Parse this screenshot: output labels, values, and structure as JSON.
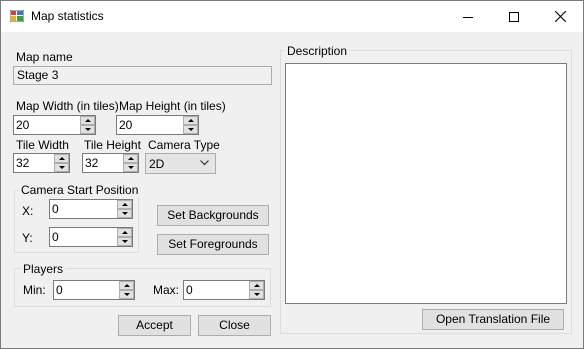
{
  "window": {
    "title": "Map statistics"
  },
  "map_name": {
    "label": "Map name",
    "value": "Stage 3"
  },
  "map_width": {
    "label": "Map Width (in tiles)",
    "value": "20"
  },
  "map_height": {
    "label": "Map Height (in tiles)",
    "value": "20"
  },
  "tile_width": {
    "label": "Tile Width",
    "value": "32"
  },
  "tile_height": {
    "label": "Tile Height",
    "value": "32"
  },
  "camera_type": {
    "label": "Camera Type",
    "value": "2D"
  },
  "camera_start": {
    "title": "Camera Start Position",
    "x_label": "X:",
    "x_value": "0",
    "y_label": "Y:",
    "y_value": "0"
  },
  "buttons": {
    "set_backgrounds": "Set Backgrounds",
    "set_foregrounds": "Set Foregrounds",
    "accept": "Accept",
    "close": "Close",
    "open_translation": "Open Translation File"
  },
  "players": {
    "title": "Players",
    "min_label": "Min:",
    "min_value": "0",
    "max_label": "Max:",
    "max_value": "0"
  },
  "description": {
    "title": "Description",
    "value": ""
  }
}
